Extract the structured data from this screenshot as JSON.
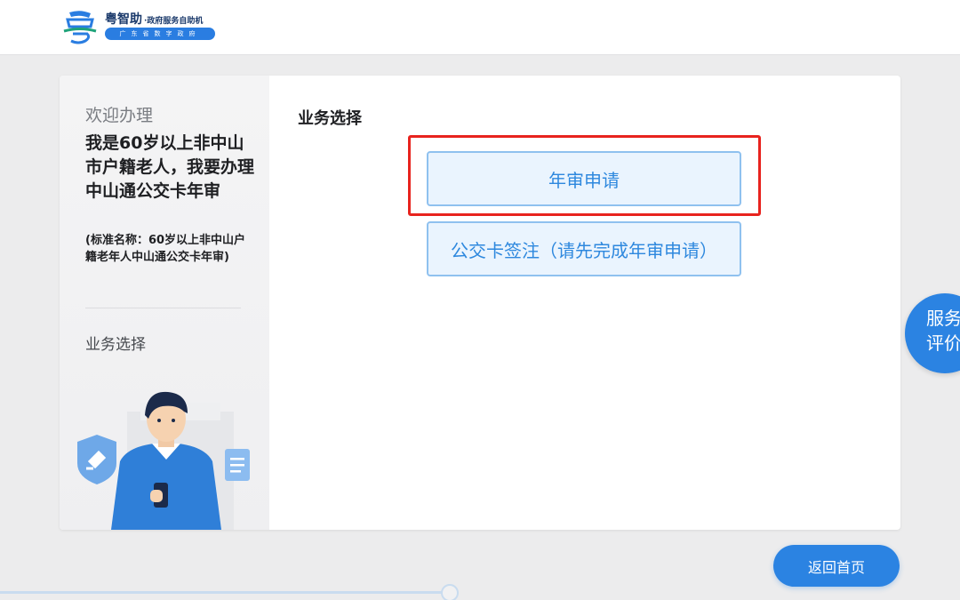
{
  "header": {
    "logo_title": "粤智助",
    "logo_subtitle": "·政府服务自助机",
    "logo_pill": "广东省数字政府",
    "logo_icon": "yue-logo-icon"
  },
  "sidebar": {
    "welcome": "欢迎办理",
    "service_title": "我是60岁以上非中山市户籍老人，我要办理中山通公交卡年审",
    "service_standard_name": "(标准名称：60岁以上非中山户籍老年人中山通公交卡年审)",
    "current_step": "业务选择"
  },
  "main": {
    "section_title": "业务选择",
    "options": [
      {
        "label": "年审申请",
        "highlighted": true
      },
      {
        "label": "公交卡签注（请先完成年审申请）",
        "highlighted": false
      }
    ]
  },
  "review_tab": {
    "line1": "服务",
    "line2": "评价"
  },
  "back_button": "返回首页",
  "colors": {
    "accent": "#2b83e2",
    "option_text": "#2e88de",
    "option_bg": "#eaf4fe",
    "highlight_border": "#e8231e"
  }
}
